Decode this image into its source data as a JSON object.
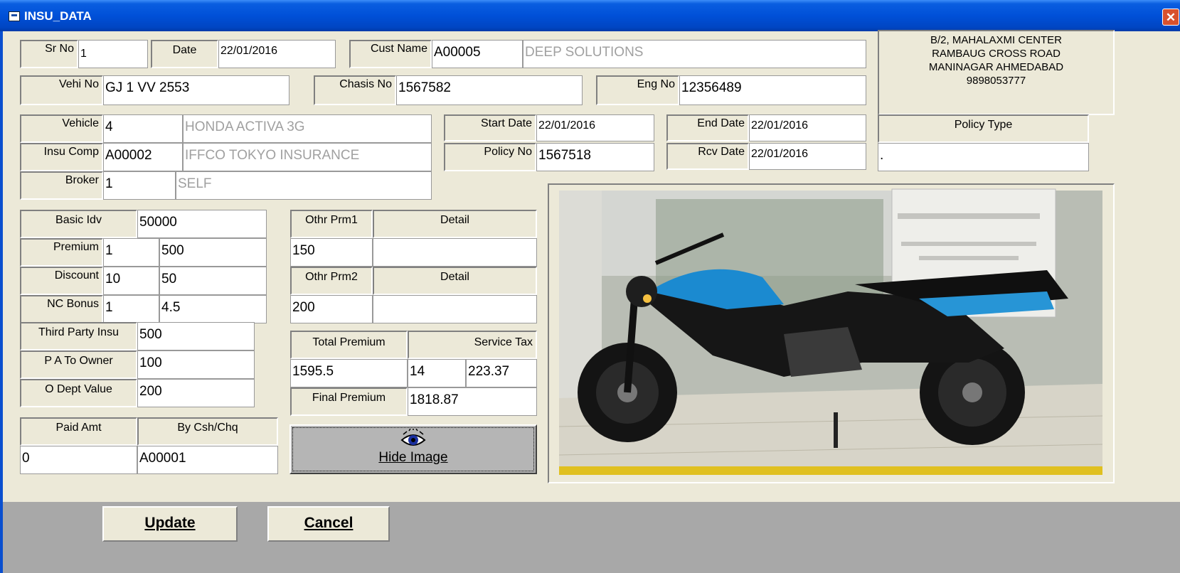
{
  "window": {
    "title": "INSU_DATA",
    "close_glyph": "✕"
  },
  "header": {
    "sr_no_label": "Sr No",
    "sr_no": "1",
    "date_label": "Date",
    "date": "22/01/2016",
    "cust_name_label": "Cust Name",
    "cust_code": "A00005",
    "cust_name": "DEEP SOLUTIONS",
    "vehi_no_label": "Vehi No",
    "vehi_no": "GJ 1 VV 2553",
    "chasis_no_label": "Chasis No",
    "chasis_no": "1567582",
    "eng_no_label": "Eng No",
    "eng_no": "12356489"
  },
  "address": {
    "line1": "B/2, MAHALAXMI CENTER",
    "line2": "RAMBAUG CROSS ROAD",
    "line3": "MANINAGAR AHMEDABAD",
    "phone": "9898053777"
  },
  "vehicle": {
    "vehicle_label": "Vehicle",
    "vehicle_code": "4",
    "vehicle_name": "HONDA ACTIVA 3G",
    "insu_comp_label": "Insu Comp",
    "insu_comp_code": "A00002",
    "insu_comp_name": "IFFCO TOKYO INSURANCE",
    "broker_label": "Broker",
    "broker_code": "1",
    "broker_name": "SELF"
  },
  "policy": {
    "start_date_label": "Start Date",
    "start_date": "22/01/2016",
    "end_date_label": "End Date",
    "end_date": "22/01/2016",
    "policy_no_label": "Policy No",
    "policy_no": "1567518",
    "rcv_date_label": "Rcv Date",
    "rcv_date": "22/01/2016",
    "policy_type_label": "Policy Type",
    "policy_type": "."
  },
  "premium": {
    "basic_idv_label": "Basic Idv",
    "basic_idv": "50000",
    "premium_label": "Premium",
    "premium_pct": "1",
    "premium_amt": "500",
    "discount_label": "Discount",
    "discount_pct": "10",
    "discount_amt": "50",
    "nc_bonus_label": "NC Bonus",
    "nc_bonus_pct": "1",
    "nc_bonus_amt": "4.5",
    "third_party_label": "Third Party Insu",
    "third_party": "500",
    "pa_owner_label": "P A To Owner",
    "pa_owner": "100",
    "o_dept_label": "O Dept Value",
    "o_dept": "200"
  },
  "other": {
    "othr_prm1_label": "Othr Prm1",
    "detail1_label": "Detail",
    "othr_prm1": "150",
    "detail1": "",
    "othr_prm2_label": "Othr Prm2",
    "detail2_label": "Detail",
    "othr_prm2": "200",
    "detail2": ""
  },
  "totals": {
    "total_premium_label": "Total Premium",
    "service_tax_label": "Service Tax",
    "total_premium": "1595.5",
    "tax_pct": "14",
    "tax_amt": "223.37",
    "final_premium_label": "Final Premium",
    "final_premium": "1818.87"
  },
  "payment": {
    "paid_amt_label": "Paid Amt",
    "by_label": "By Csh/Chq",
    "paid_amt": "0",
    "by_code": "A00001"
  },
  "image": {
    "hide_button_label": "Hide Image",
    "hide_button_icon": "eye-icon"
  },
  "actions": {
    "update_label": "Update",
    "cancel_label": "Cancel"
  },
  "colors": {
    "titlebar": "#0050d8",
    "window_bg": "#ECE9D8",
    "close_button": "#d8512d",
    "bottom_band": "#a8a8a8"
  }
}
